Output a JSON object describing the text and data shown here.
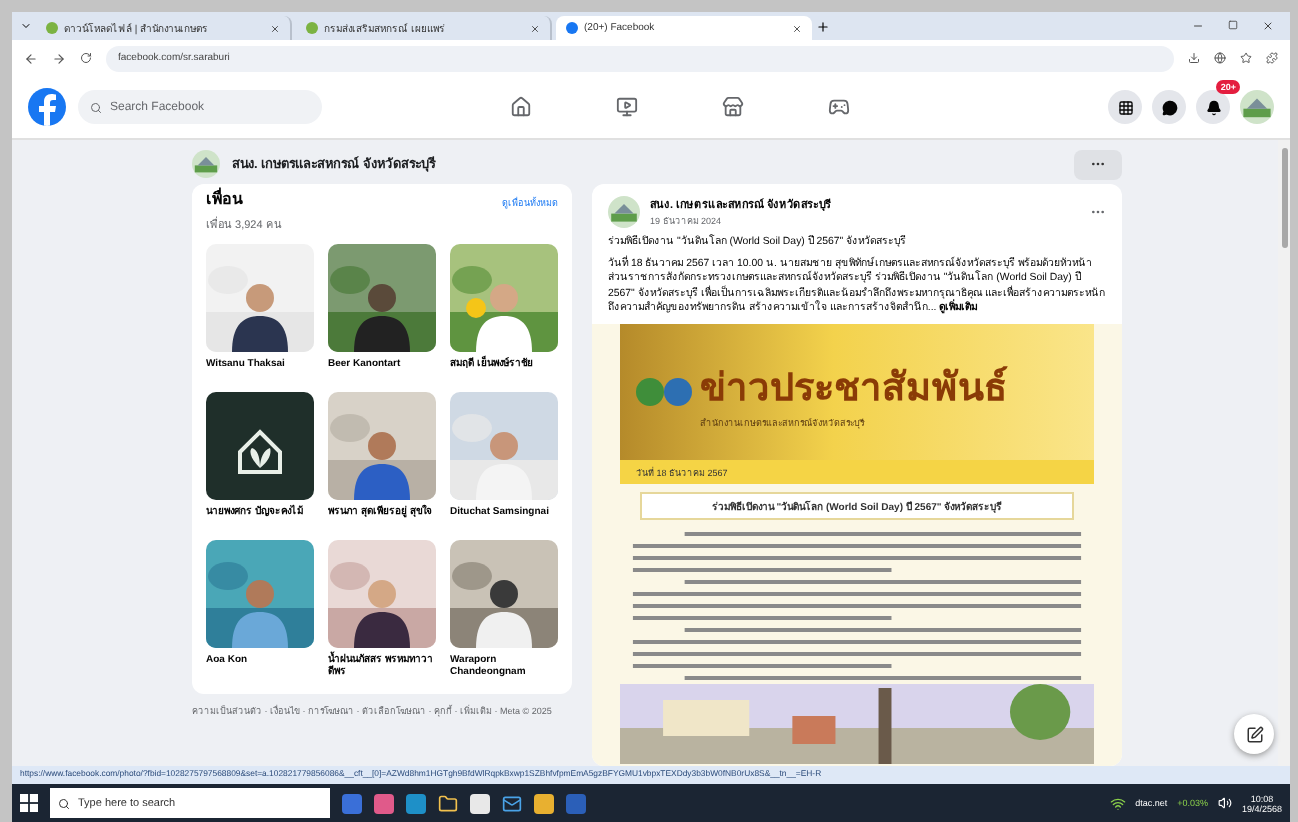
{
  "browser": {
    "tabs": [
      {
        "title": "ดาวน์โหลดไฟล์ | สำนักงานเกษตร",
        "kind": "site",
        "selected": false
      },
      {
        "title": "กรมส่งเสริมสหกรณ์ เผยแพร่",
        "kind": "site",
        "selected": false
      },
      {
        "title": "(20+) Facebook",
        "kind": "facebook",
        "selected": true
      }
    ],
    "url": "facebook.com/sr.saraburi"
  },
  "facebook": {
    "search": {
      "placeholder": "Search Facebook"
    },
    "notification_badge": "20+"
  },
  "page": {
    "name": "สนง. เกษตรและสหกรณ์ จังหวัดสระบุรี"
  },
  "friends": {
    "heading": "เพื่อน",
    "link": "ดูเพื่อนทั้งหมด",
    "count": "เพื่อน 3,924 คน",
    "items": [
      {
        "name": "Witsanu Thaksai"
      },
      {
        "name": "Beer Kanontart"
      },
      {
        "name": "สมฤดี เย็นพงษ์ราชัย"
      },
      {
        "name": "นายพงศกร ปัญจะคงไม้"
      },
      {
        "name": "พรนภา สุดเพียรอยู่ สุขใจ"
      },
      {
        "name": "Dituchat Samsingnai"
      },
      {
        "name": "Aoa Kon"
      },
      {
        "name": "น้ำฝนนภัสสร พรหมทาวาดีพร"
      },
      {
        "name": "Waraporn Chandeongnam"
      }
    ],
    "footer": "ความเป็นส่วนตัว · เงื่อนไข · การโฆษณา · ตัวเลือกโฆษณา · คุกกี้ · เพิ่มเติม · Meta © 2025"
  },
  "post": {
    "author": "สนง. เกษตรและสหกรณ์ จังหวัดสระบุรี",
    "date": "19 ธันวาคม 2024",
    "title": "ร่วมพิธีเปิดงาน \"วันดินโลก (World Soil Day) ปี 2567\" จังหวัดสระบุรี",
    "body": "วันที่ 18 ธันวาคม 2567 เวลา 10.00 น. นายสมชาย สุขพิทักษ์ เกษตรและสหกรณ์จังหวัดสระบุรี พร้อมด้วยหัวหน้าส่วนราชการสังกัดกระทรวงเกษตรและสหกรณ์จังหวัดสระบุรี ร่วมพิธีเปิดงาน \"วันดินโลก (World Soil Day) ปี 2567\" จังหวัดสระบุรี เพื่อเป็นการเฉลิมพระเกียรติและน้อมรำลึกถึงพระมหากรุณาธิคุณ และเพื่อสร้างความตระหนักถึงความสำคัญของทรัพยากรดิน สร้างความเข้าใจ และการสร้างจิตสำนึก...",
    "more": "ดูเพิ่มเติม",
    "poster": {
      "headline": "ข่าวประชาสัมพันธ์",
      "subtitle": "สำนักงานเกษตรและสหกรณ์จังหวัดสระบุรี",
      "date": "วันที่ 18 ธันวาคม 2567",
      "caption": "ร่วมพิธีเปิดงาน \"วันดินโลก (World Soil Day) ปี 2567\" จังหวัดสระบุรี"
    }
  },
  "status_url": "https://www.facebook.com/photo/?fbid=1028275797568809&set=a.102821779856086&__cft__[0]=AZWd8hm1HGTgh9BfdWlRqpkBxwp1SZBhfvfpmEmA5gzBFYGMU1vbpxTEXDdy3b3bW0fNB0rUx8S&__tn__=EH-R",
  "taskbar": {
    "search": {
      "placeholder": "Type here to search"
    },
    "network": "dtac.net",
    "change": "+0.03%",
    "time": "10:08",
    "date": "19/4/2568"
  }
}
